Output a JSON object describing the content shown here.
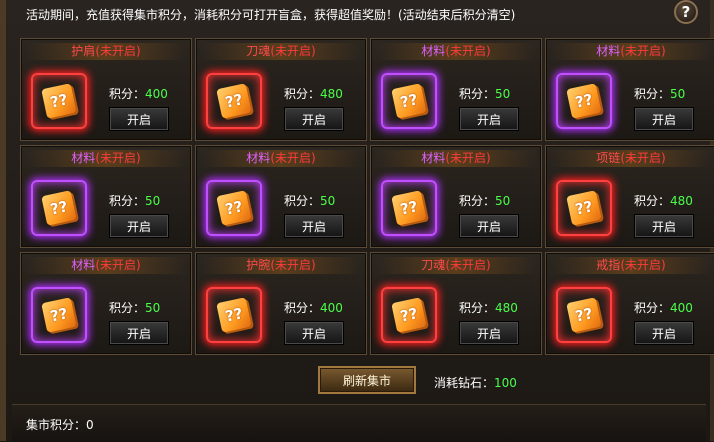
{
  "notice": "活动期间，充值获得集市积分，消耗积分可打开盲盒，获得超值奖励！(活动结束后积分清空)",
  "help_label": "?",
  "score_label": "积分：",
  "open_label": "开启",
  "cards": [
    {
      "name": "护肩",
      "status": "(未开启)",
      "rarity": "red",
      "score": "400"
    },
    {
      "name": "刀魂",
      "status": "(未开启)",
      "rarity": "red",
      "score": "480"
    },
    {
      "name": "材料",
      "status": "(未开启)",
      "rarity": "purple",
      "score": "50"
    },
    {
      "name": "材料",
      "status": "(未开启)",
      "rarity": "purple",
      "score": "50"
    },
    {
      "name": "材料",
      "status": "(未开启)",
      "rarity": "purple",
      "score": "50"
    },
    {
      "name": "材料",
      "status": "(未开启)",
      "rarity": "purple",
      "score": "50"
    },
    {
      "name": "材料",
      "status": "(未开启)",
      "rarity": "purple",
      "score": "50"
    },
    {
      "name": "项链",
      "status": "(未开启)",
      "rarity": "red",
      "score": "480"
    },
    {
      "name": "材料",
      "status": "(未开启)",
      "rarity": "purple",
      "score": "50"
    },
    {
      "name": "护腕",
      "status": "(未开启)",
      "rarity": "red",
      "score": "400"
    },
    {
      "name": "刀魂",
      "status": "(未开启)",
      "rarity": "red",
      "score": "480"
    },
    {
      "name": "戒指",
      "status": "(未开启)",
      "rarity": "red",
      "score": "400"
    }
  ],
  "chest_glyph": "??",
  "refresh_label": "刷新集市",
  "cost_label": "消耗钻石：",
  "cost_value": "100",
  "market_score_label": "集市积分：",
  "market_score_value": "0"
}
